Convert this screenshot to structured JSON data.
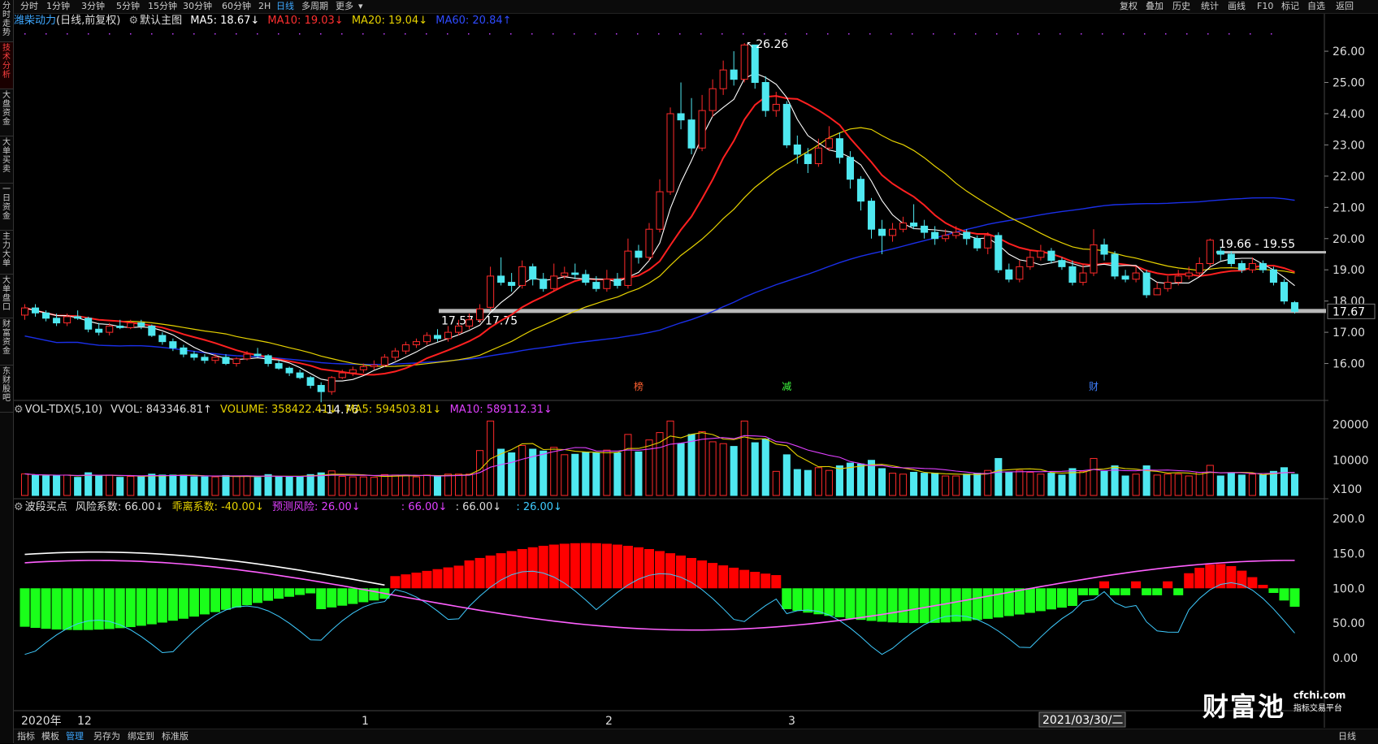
{
  "left_tabs": [
    {
      "label": "分时走势",
      "active": false
    },
    {
      "label": "技术分析",
      "active": true
    },
    {
      "label": "大盘资金",
      "active": false
    },
    {
      "label": "大单买卖",
      "active": false
    },
    {
      "label": "一日资金",
      "active": false
    },
    {
      "label": "主力大单",
      "active": false
    },
    {
      "label": "大单盘口",
      "active": false
    },
    {
      "label": "财富资金",
      "active": false
    },
    {
      "label": "东财股吧",
      "active": false
    }
  ],
  "periods": [
    "分时",
    "1分钟",
    "3分钟",
    "5分钟",
    "15分钟",
    "30分钟",
    "60分钟",
    "2H",
    "日线",
    "多周期",
    "更多"
  ],
  "active_period": "日线",
  "right_tools": [
    "复权",
    "叠加",
    "历史",
    "统计",
    "画线",
    "F10",
    "标记",
    "自选",
    "返回"
  ],
  "main": {
    "stock_name": "潍柴动力",
    "mode": "(日线,前复权)",
    "chart_type": "默认主图",
    "ma5": "MA5: 18.67↓",
    "ma10": "MA10: 19.03↓",
    "ma20": "MA20: 19.04↓",
    "ma60": "MA60: 20.84↑",
    "high_label": "26.26",
    "low_label": "14.76",
    "range1_label": "17.57 - 17.75",
    "range2_label": "19.66 - 19.55",
    "current_price": "17.67",
    "price_ticks": [
      "26.00",
      "25.00",
      "24.00",
      "23.00",
      "22.00",
      "21.00",
      "20.00",
      "19.00",
      "18.00",
      "17.00",
      "16.00"
    ],
    "markers": [
      "榜",
      "减",
      "财"
    ]
  },
  "volume": {
    "title": "VOL-TDX(5,10)",
    "vvol": "VVOL: 843346.81↑",
    "volume": "VOLUME: 358422.41↓",
    "ma5": "MA5: 594503.81↓",
    "ma10": "MA10: 589112.31↓",
    "ticks": [
      "20000",
      "10000"
    ],
    "unit": "X100"
  },
  "indicator": {
    "title": "波段买点",
    "risk": "风险系数: 66.00↓",
    "deviation": "乖离系数: -40.00↓",
    "forecast": "预测风险: 26.00↓",
    "extra1": ": 66.00↓",
    "extra2": ": 66.00↓",
    "extra3": ": 26.00↓",
    "ticks": [
      "200.0",
      "150.0",
      "100.0",
      "50.00",
      "0.00"
    ]
  },
  "date_axis": {
    "labels": [
      "2020年",
      "12",
      "1",
      "2",
      "3"
    ],
    "cursor_date": "2021/03/30/二"
  },
  "bottom_tabs": [
    "指标",
    "模板",
    "管理",
    "另存为",
    "绑定到",
    "标准版"
  ],
  "active_bottom_tab": "管理",
  "bottom_right": "日线",
  "watermark": {
    "main": "财富池",
    "site": "cfchi.com",
    "sub": "指标交易平台"
  },
  "colors": {
    "up": "#ff2a2a",
    "down": "#4fe8f0",
    "ma5": "#ffffff",
    "ma10": "#ff2020",
    "ma20": "#e6d200",
    "ma60": "#1a2fe8",
    "accent": "#3ea8ff"
  },
  "chart_data": {
    "type": "candlestick",
    "y_price_range": [
      15.0,
      26.6
    ],
    "candles": [
      [
        17.55,
        17.78,
        17.9,
        17.4
      ],
      [
        17.78,
        17.62,
        17.9,
        17.5
      ],
      [
        17.62,
        17.45,
        17.7,
        17.35
      ],
      [
        17.45,
        17.3,
        17.6,
        17.2
      ],
      [
        17.3,
        17.5,
        17.6,
        17.2
      ],
      [
        17.5,
        17.45,
        17.7,
        17.4
      ],
      [
        17.45,
        17.1,
        17.5,
        17.0
      ],
      [
        17.1,
        17.0,
        17.3,
        16.9
      ],
      [
        17.0,
        17.2,
        17.3,
        16.9
      ],
      [
        17.2,
        17.15,
        17.4,
        17.1
      ],
      [
        17.15,
        17.3,
        17.4,
        17.1
      ],
      [
        17.3,
        17.2,
        17.4,
        17.1
      ],
      [
        17.2,
        16.9,
        17.25,
        16.85
      ],
      [
        16.9,
        16.7,
        17.0,
        16.6
      ],
      [
        16.7,
        16.5,
        16.8,
        16.4
      ],
      [
        16.5,
        16.3,
        16.6,
        16.2
      ],
      [
        16.3,
        16.2,
        16.4,
        16.1
      ],
      [
        16.2,
        16.1,
        16.3,
        16.0
      ],
      [
        16.1,
        16.2,
        16.3,
        16.0
      ],
      [
        16.2,
        16.0,
        16.3,
        15.95
      ],
      [
        16.0,
        16.15,
        16.2,
        15.9
      ],
      [
        16.15,
        16.3,
        16.4,
        16.1
      ],
      [
        16.3,
        16.25,
        16.5,
        16.2
      ],
      [
        16.25,
        16.0,
        16.3,
        15.9
      ],
      [
        16.0,
        15.85,
        16.1,
        15.8
      ],
      [
        15.85,
        15.7,
        15.9,
        15.6
      ],
      [
        15.7,
        15.55,
        15.8,
        15.5
      ],
      [
        15.55,
        15.3,
        15.6,
        15.2
      ],
      [
        15.3,
        15.1,
        15.4,
        14.76
      ],
      [
        15.1,
        15.55,
        15.6,
        15.0
      ],
      [
        15.55,
        15.7,
        15.8,
        15.5
      ],
      [
        15.7,
        15.8,
        15.9,
        15.6
      ],
      [
        15.8,
        15.9,
        16.0,
        15.7
      ],
      [
        15.9,
        15.95,
        16.1,
        15.8
      ],
      [
        15.95,
        16.2,
        16.3,
        15.9
      ],
      [
        16.2,
        16.4,
        16.5,
        16.1
      ],
      [
        16.4,
        16.6,
        16.7,
        16.3
      ],
      [
        16.6,
        16.7,
        16.8,
        16.5
      ],
      [
        16.7,
        16.9,
        17.0,
        16.6
      ],
      [
        16.9,
        16.8,
        17.1,
        16.7
      ],
      [
        16.8,
        17.0,
        17.2,
        16.7
      ],
      [
        17.0,
        17.2,
        17.4,
        16.9
      ],
      [
        17.2,
        17.4,
        17.6,
        17.1
      ],
      [
        17.4,
        17.75,
        17.9,
        17.3
      ],
      [
        17.8,
        18.8,
        19.1,
        17.7
      ],
      [
        18.8,
        18.6,
        19.4,
        18.5
      ],
      [
        18.6,
        18.5,
        18.9,
        18.3
      ],
      [
        18.5,
        19.1,
        19.3,
        18.4
      ],
      [
        19.1,
        18.7,
        19.2,
        18.5
      ],
      [
        18.7,
        18.4,
        18.9,
        18.3
      ],
      [
        18.4,
        18.8,
        19.2,
        18.3
      ],
      [
        18.8,
        18.9,
        19.1,
        18.7
      ],
      [
        18.9,
        18.85,
        19.2,
        18.7
      ],
      [
        18.85,
        18.6,
        19.0,
        18.5
      ],
      [
        18.6,
        18.4,
        18.8,
        18.3
      ],
      [
        18.4,
        18.7,
        19.0,
        18.3
      ],
      [
        18.7,
        18.5,
        18.9,
        18.4
      ],
      [
        18.5,
        19.6,
        20.0,
        18.4
      ],
      [
        19.6,
        19.4,
        19.8,
        19.2
      ],
      [
        19.4,
        20.3,
        20.5,
        19.3
      ],
      [
        20.3,
        21.5,
        21.9,
        20.2
      ],
      [
        21.5,
        24.0,
        24.2,
        21.4
      ],
      [
        24.0,
        23.8,
        25.0,
        23.5
      ],
      [
        23.8,
        22.9,
        24.5,
        22.7
      ],
      [
        22.9,
        24.1,
        24.6,
        22.8
      ],
      [
        24.1,
        24.8,
        25.1,
        23.9
      ],
      [
        24.8,
        25.4,
        25.7,
        24.6
      ],
      [
        25.4,
        25.1,
        26.0,
        24.9
      ],
      [
        25.1,
        26.2,
        26.26,
        25.0
      ],
      [
        26.2,
        25.0,
        25.4,
        24.8
      ],
      [
        25.0,
        24.1,
        25.2,
        23.9
      ],
      [
        24.1,
        24.3,
        24.7,
        23.9
      ],
      [
        24.3,
        23.0,
        24.4,
        22.9
      ],
      [
        23.0,
        22.7,
        23.3,
        22.4
      ],
      [
        22.7,
        22.4,
        22.9,
        22.1
      ],
      [
        22.4,
        22.9,
        23.2,
        22.3
      ],
      [
        22.9,
        23.2,
        23.6,
        22.8
      ],
      [
        23.2,
        22.6,
        23.4,
        22.4
      ],
      [
        22.6,
        21.9,
        22.8,
        21.6
      ],
      [
        21.9,
        21.2,
        22.0,
        20.9
      ],
      [
        21.2,
        20.3,
        21.3,
        20.0
      ],
      [
        20.3,
        20.1,
        20.6,
        19.5
      ],
      [
        20.1,
        20.3,
        20.5,
        19.9
      ],
      [
        20.3,
        20.5,
        20.7,
        20.2
      ],
      [
        20.5,
        20.4,
        21.1,
        20.3
      ],
      [
        20.4,
        20.2,
        20.6,
        20.0
      ],
      [
        20.2,
        20.0,
        20.4,
        19.8
      ],
      [
        20.0,
        20.1,
        20.3,
        19.9
      ],
      [
        20.1,
        20.2,
        20.4,
        20.0
      ],
      [
        20.2,
        20.0,
        20.3,
        19.8
      ],
      [
        20.0,
        19.7,
        20.1,
        19.6
      ],
      [
        19.7,
        20.1,
        20.2,
        19.5
      ],
      [
        20.1,
        19.0,
        20.2,
        18.9
      ],
      [
        19.0,
        18.7,
        19.2,
        18.6
      ],
      [
        18.7,
        19.1,
        19.3,
        18.6
      ],
      [
        19.1,
        19.4,
        19.6,
        19.0
      ],
      [
        19.4,
        19.6,
        19.8,
        19.3
      ],
      [
        19.6,
        19.3,
        19.7,
        19.2
      ],
      [
        19.3,
        19.1,
        19.4,
        19.0
      ],
      [
        19.1,
        18.6,
        19.3,
        18.5
      ],
      [
        18.6,
        18.9,
        19.2,
        18.5
      ],
      [
        18.9,
        19.8,
        20.3,
        18.8
      ],
      [
        19.8,
        19.5,
        20.0,
        19.3
      ],
      [
        19.5,
        18.8,
        19.6,
        18.7
      ],
      [
        18.8,
        18.7,
        19.0,
        18.6
      ],
      [
        18.7,
        18.9,
        19.1,
        18.6
      ],
      [
        18.9,
        18.2,
        19.0,
        18.1
      ],
      [
        18.2,
        18.4,
        18.6,
        18.2
      ],
      [
        18.4,
        18.6,
        18.8,
        18.3
      ],
      [
        18.6,
        18.8,
        19.0,
        18.5
      ],
      [
        18.8,
        18.9,
        19.1,
        18.7
      ],
      [
        18.9,
        19.2,
        19.4,
        18.8
      ],
      [
        19.2,
        19.95,
        20.0,
        19.1
      ],
      [
        19.6,
        19.5,
        19.7,
        19.3
      ],
      [
        19.5,
        19.2,
        19.6,
        19.1
      ],
      [
        19.2,
        19.0,
        19.3,
        18.9
      ],
      [
        19.0,
        19.2,
        19.4,
        18.9
      ],
      [
        19.2,
        19.0,
        19.3,
        18.9
      ],
      [
        19.0,
        18.6,
        19.1,
        18.5
      ],
      [
        18.6,
        18.0,
        18.7,
        17.9
      ],
      [
        17.95,
        17.67,
        18.0,
        17.6
      ]
    ]
  }
}
